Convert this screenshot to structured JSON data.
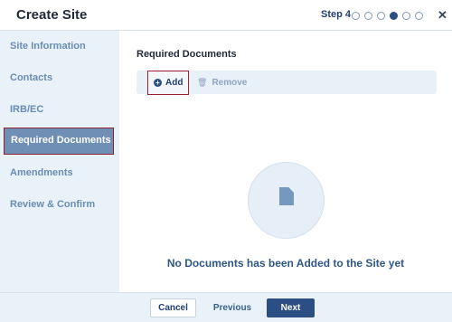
{
  "dialog": {
    "title": "Create Site",
    "step_label": "Step 4",
    "step_count": 6,
    "active_step": 4,
    "close_icon": "close-icon"
  },
  "sidebar": {
    "items": [
      {
        "label": "Site Information"
      },
      {
        "label": "Contacts"
      },
      {
        "label": "IRB/EC"
      },
      {
        "label": "Required Documents"
      },
      {
        "label": "Amendments"
      },
      {
        "label": "Review & Confirm"
      }
    ],
    "active_index": 3
  },
  "main": {
    "section_title": "Required Documents",
    "toolbar": {
      "add_label": "Add",
      "add_icon": "plus-circle-icon",
      "remove_label": "Remove",
      "remove_icon": "trash-icon"
    },
    "empty_state": {
      "icon": "file-icon",
      "message": "No Documents has been Added to the Site yet"
    }
  },
  "footer": {
    "cancel_label": "Cancel",
    "previous_label": "Previous",
    "next_label": "Next"
  },
  "colors": {
    "primary": "#2b4f83",
    "sidebar_bg": "#e9f1f9",
    "sidebar_active_bg": "#6f8fb4",
    "highlight_border": "#a01b2b"
  }
}
